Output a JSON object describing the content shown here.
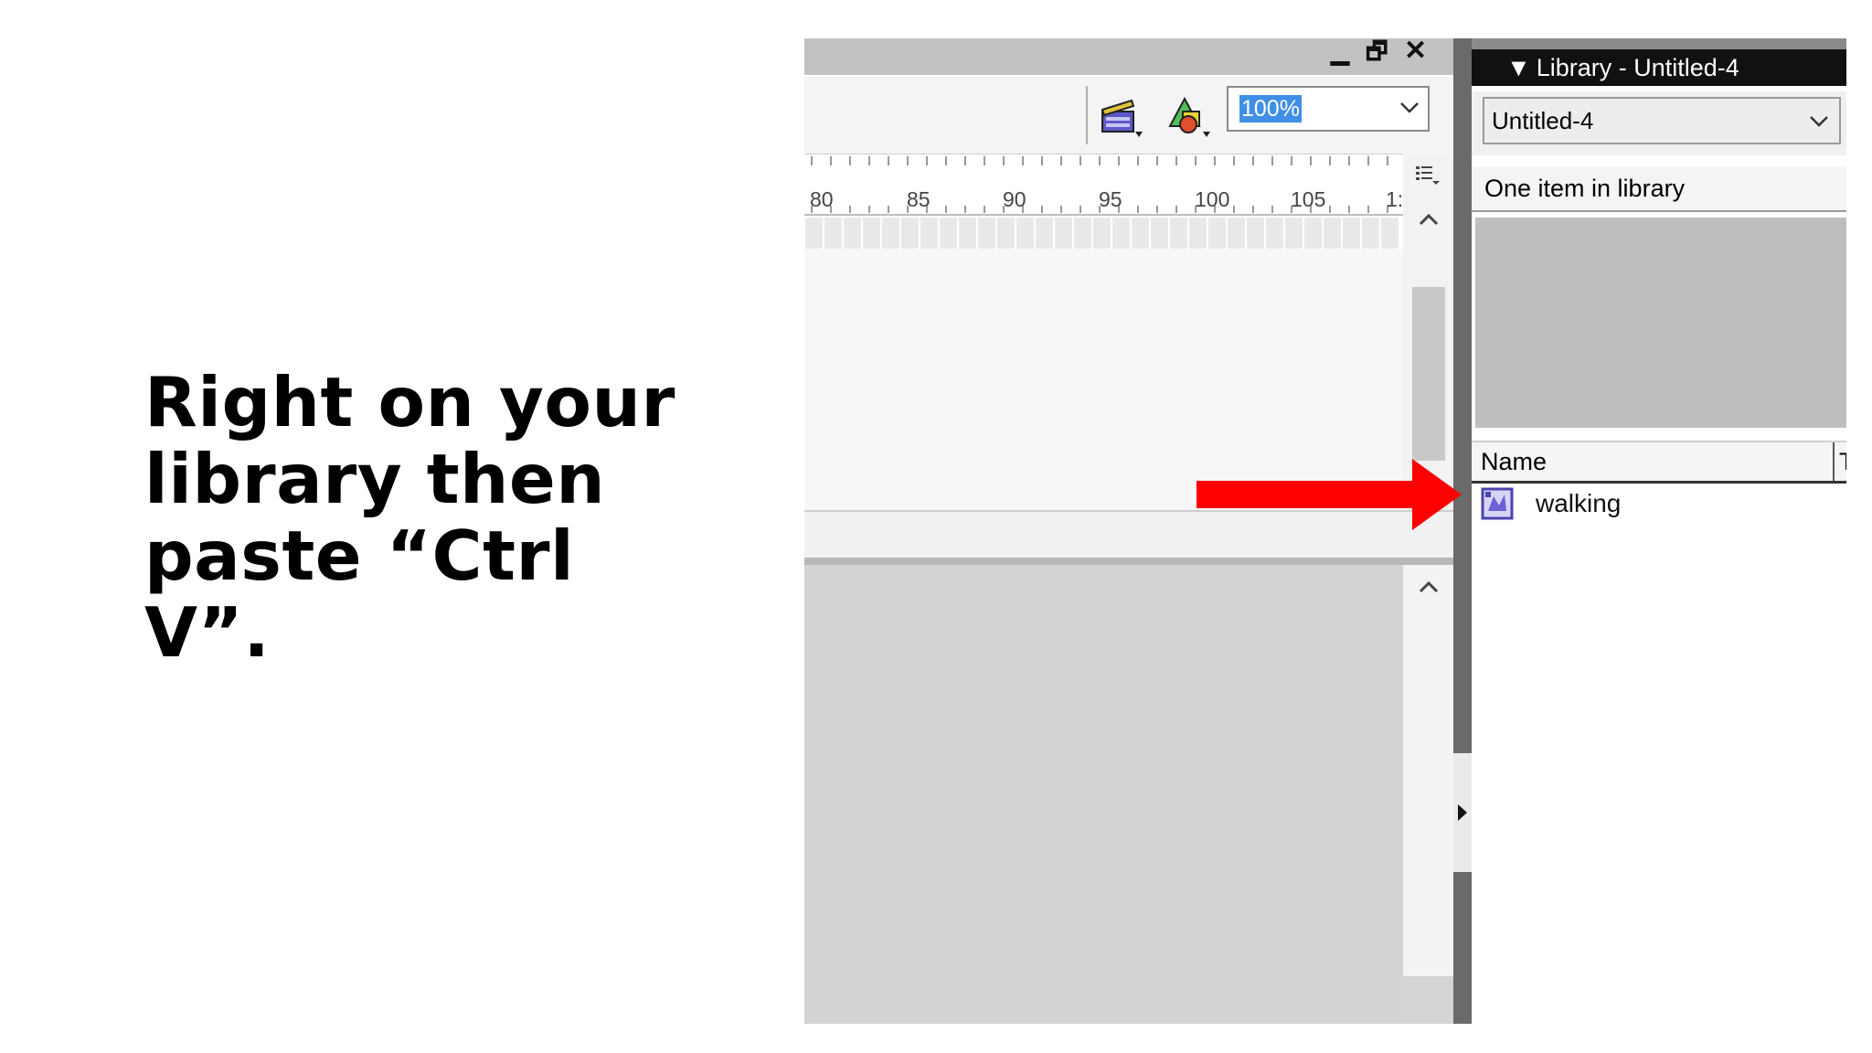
{
  "slide": {
    "instruction": "Right on your library then paste “Ctrl V”."
  },
  "window_controls": {
    "minimize": "▁",
    "restore": "🗗",
    "close": "✕"
  },
  "timeline": {
    "zoom": "100%",
    "ruler_labels": [
      "80",
      "85",
      "90",
      "95",
      "100",
      "105",
      "1:"
    ]
  },
  "library": {
    "title": "Library - Untitled-4",
    "document_select": "Untitled-4",
    "item_count": "One item in library",
    "columns": {
      "name": "Name",
      "type": "T"
    },
    "items": [
      {
        "name": "walking",
        "icon": "movie-clip-symbol-icon"
      }
    ]
  },
  "colors": {
    "arrow": "#ff0000",
    "selection": "#3f8fe6",
    "library_header": "#111111"
  }
}
